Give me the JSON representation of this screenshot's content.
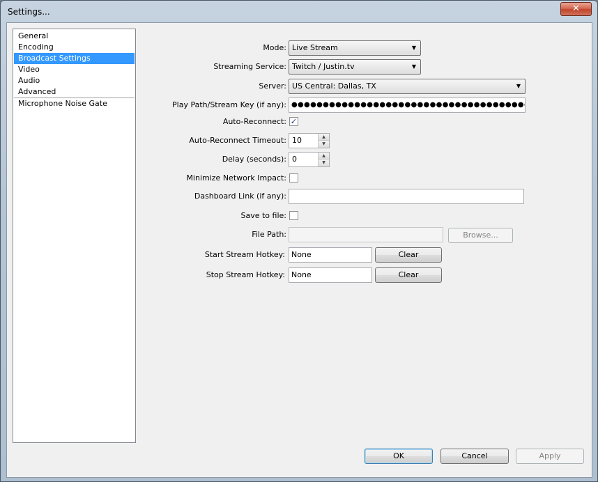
{
  "window": {
    "title": "Settings...",
    "close_glyph": "✕"
  },
  "categories": [
    {
      "label": "General",
      "selected": false
    },
    {
      "label": "Encoding",
      "selected": false
    },
    {
      "label": "Broadcast Settings",
      "selected": true
    },
    {
      "label": "Video",
      "selected": false
    },
    {
      "label": "Audio",
      "selected": false
    },
    {
      "label": "Advanced",
      "selected": false
    },
    {
      "label": "Microphone Noise Gate",
      "selected": false
    }
  ],
  "form": {
    "mode": {
      "label": "Mode:",
      "value": "Live Stream"
    },
    "streaming_service": {
      "label": "Streaming Service:",
      "value": "Twitch / Justin.tv"
    },
    "server": {
      "label": "Server:",
      "value": "US Central: Dallas, TX"
    },
    "stream_key": {
      "label": "Play Path/Stream Key (if any):",
      "value": "●●●●●●●●●●●●●●●●●●●●●●●●●●●●●●●●●●●●●●●●●●●●"
    },
    "auto_reconnect": {
      "label": "Auto-Reconnect:",
      "checked": true,
      "glyph": "✓"
    },
    "auto_reconnect_timeout": {
      "label": "Auto-Reconnect Timeout:",
      "value": "10"
    },
    "delay": {
      "label": "Delay (seconds):",
      "value": "0"
    },
    "minimize_network": {
      "label": "Minimize Network Impact:",
      "checked": false
    },
    "dashboard_link": {
      "label": "Dashboard Link (if any):",
      "value": ""
    },
    "save_to_file": {
      "label": "Save to file:",
      "checked": false
    },
    "file_path": {
      "label": "File Path:",
      "value": "",
      "browse_label": "Browse..."
    },
    "start_hotkey": {
      "label": "Start Stream Hotkey:",
      "value": "None",
      "clear_label": "Clear"
    },
    "stop_hotkey": {
      "label": "Stop Stream Hotkey:",
      "value": "None",
      "clear_label": "Clear"
    }
  },
  "buttons": {
    "ok": "OK",
    "cancel": "Cancel",
    "apply": "Apply"
  },
  "icons": {
    "dropdown": "▼",
    "spin_up": "▲",
    "spin_down": "▼"
  },
  "colors": {
    "selection": "#3399ff",
    "close_red": "#c0442b"
  }
}
